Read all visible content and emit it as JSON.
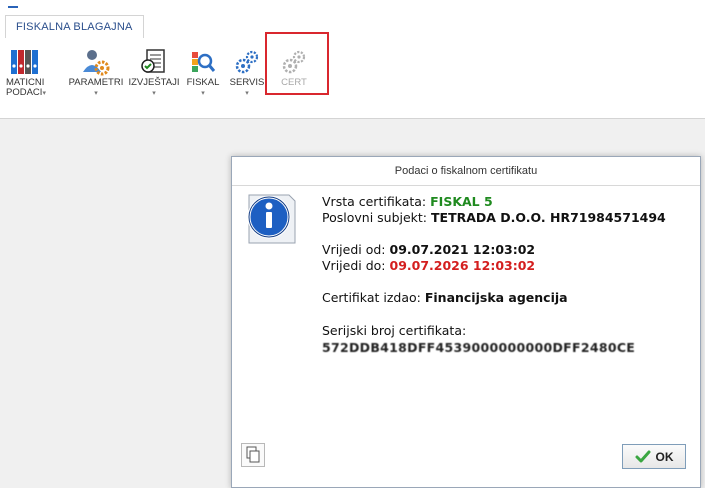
{
  "tab": {
    "label": "FISKALNA BLAGAJNA"
  },
  "ribbon": {
    "buttons": [
      {
        "line1": "MATICNI",
        "line2": "PODACI",
        "arrow": "▾",
        "icon": "binders-icon"
      },
      {
        "line1": "PARAMETRI",
        "arrow": "▾",
        "icon": "user-settings-icon"
      },
      {
        "line1": "IZVJEŠTAJI",
        "arrow": "▾",
        "icon": "report-icon"
      },
      {
        "line1": "FISKAL",
        "arrow": "▾",
        "icon": "fiscal-search-icon"
      },
      {
        "line1": "SERVIS",
        "arrow": "▾",
        "icon": "gears-icon"
      },
      {
        "line1": "CERT",
        "icon": "gears-disabled-icon"
      }
    ]
  },
  "dialog": {
    "title": "Podaci o fiskalnom certifikatu",
    "type_label": "Vrsta certifikata:",
    "type_value": "FISKAL 5",
    "subject_label": "Poslovni subjekt:",
    "subject_value": "TETRADA D.O.O. HR71984571494",
    "valid_from_label": "Vrijedi od:",
    "valid_from_value": "09.07.2021 12:03:02",
    "valid_to_label": "Vrijedi do:",
    "valid_to_value": "09.07.2026 12:03:02",
    "issuer_label": "Certifikat izdao:",
    "issuer_value": "Financijska agencija",
    "serial_label": "Serijski broj certifikata:",
    "serial_value": "572DDB418DFF4539000000000DFF2480CE",
    "ok_label": "OK"
  },
  "colors": {
    "green": "#1f8a1f",
    "red": "#d41f1f",
    "highlight": "#d9272e"
  }
}
